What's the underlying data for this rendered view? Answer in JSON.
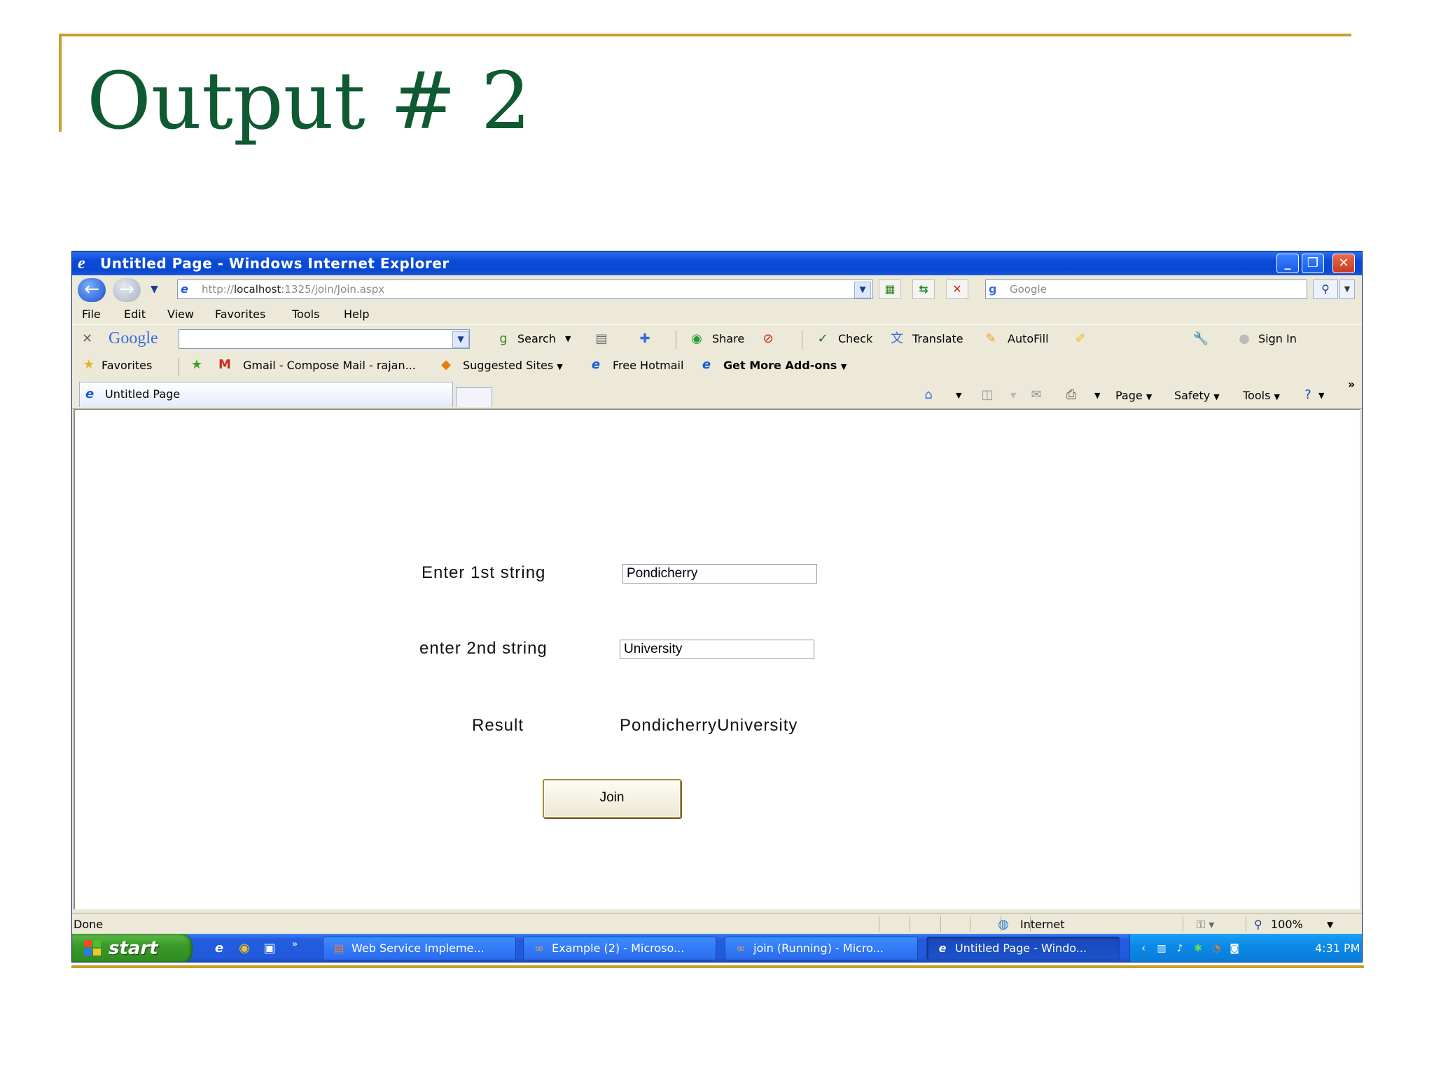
{
  "slide": {
    "title": "Output # 2"
  },
  "window": {
    "title": "Untitled Page - Windows Internet Explorer",
    "controls": {
      "minimize": "_",
      "maximize": "❐",
      "close": "✕"
    }
  },
  "address": {
    "scheme": "http://",
    "host": "localhost",
    "rest": ":1325/join/Join.aspx",
    "search_placeholder": "Google"
  },
  "menu": [
    "File",
    "Edit",
    "View",
    "Favorites",
    "Tools",
    "Help"
  ],
  "google_toolbar": {
    "logo": "Google",
    "search": "Search",
    "share": "Share",
    "check": "Check",
    "translate": "Translate",
    "autofill": "AutoFill",
    "sign_in": "Sign In"
  },
  "favorites_bar": {
    "favorites": "Favorites",
    "gmail": "Gmail - Compose Mail - rajan...",
    "suggested": "Suggested Sites",
    "hotmail": "Free Hotmail",
    "addons": "Get More Add-ons"
  },
  "tab": {
    "label": "Untitled Page"
  },
  "command_bar": {
    "page": "Page",
    "safety": "Safety",
    "tools": "Tools",
    "more": "»"
  },
  "form": {
    "label1": "Enter 1st string",
    "value1": "Pondicherry",
    "label2": "enter 2nd string",
    "value2": "University",
    "result_label": "Result",
    "result_value": "PondicherryUniversity",
    "button": "Join"
  },
  "status": {
    "text": "Done",
    "zone": "Internet",
    "zoom": "100%"
  },
  "taskbar": {
    "start": "start",
    "tasks": [
      {
        "label": "Web Service Impleme...",
        "icon": "powerpoint-icon"
      },
      {
        "label": "Example (2) - Microso...",
        "icon": "visual-studio-icon"
      },
      {
        "label": "join (Running) - Micro...",
        "icon": "visual-studio-icon"
      },
      {
        "label": "Untitled Page - Windo...",
        "icon": "internet-explorer-icon"
      }
    ],
    "clock": "4:31 PM"
  },
  "colors": {
    "slide_title": "#0f5a32",
    "slide_rule": "#c8a02a",
    "xp_blue": "#0848d0",
    "start_green": "#3a9a2a"
  }
}
